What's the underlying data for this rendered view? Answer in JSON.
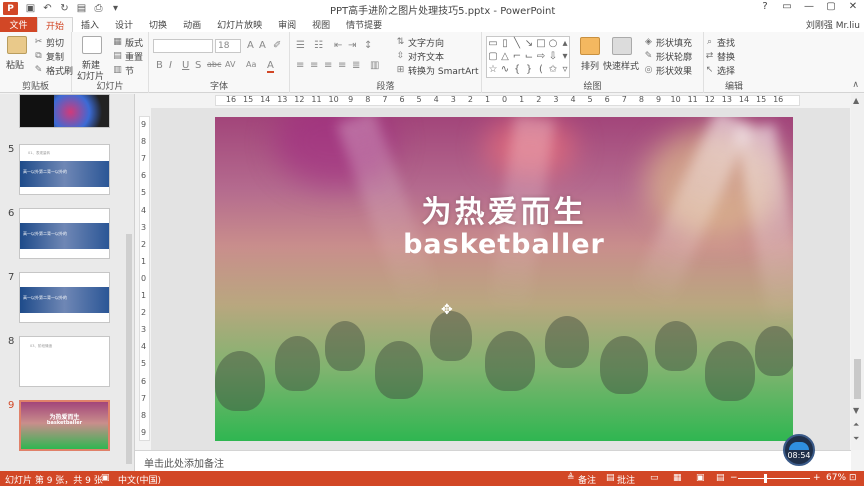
{
  "titlebar": {
    "app_icon": "P",
    "title": "PPT高手进阶之图片处理技巧5.pptx - PowerPoint",
    "qat_icons": [
      "save-icon",
      "undo-icon",
      "redo-icon",
      "start-from-beginning-icon",
      "print-icon",
      "more-icon"
    ],
    "window_buttons": [
      "?",
      "▭",
      "—",
      "▢",
      "✕"
    ]
  },
  "tabs": {
    "file": "文件",
    "items": [
      "开始",
      "插入",
      "设计",
      "切换",
      "动画",
      "幻灯片放映",
      "审阅",
      "视图",
      "情节提要"
    ],
    "active": "开始",
    "user": "刘刚强 Mr.liu"
  },
  "ribbon": {
    "clipboard": {
      "paste": "粘贴",
      "cut": "剪切",
      "copy": "复制",
      "format_painter": "格式刷",
      "label": "剪贴板"
    },
    "slides": {
      "new_slide_1": "新建",
      "new_slide_2": "幻灯片",
      "layout": "版式",
      "reset": "重置",
      "section": "节",
      "label": "幻灯片"
    },
    "font": {
      "size": "18",
      "bold": "B",
      "italic": "I",
      "underline": "U",
      "shadow": "S",
      "strike": "abc",
      "spacing": "AV",
      "case": "Aa",
      "color": "A",
      "label": "字体"
    },
    "paragraph": {
      "text_direction": "文字方向",
      "align_text": "对齐文本",
      "convert_smartart": "转换为 SmartArt",
      "label": "段落"
    },
    "drawing": {
      "arrange": "排列",
      "quick_styles": "快速样式",
      "shape_fill": "形状填充",
      "shape_outline": "形状轮廓",
      "shape_effects": "形状效果",
      "label": "绘图"
    },
    "editing": {
      "find": "查找",
      "replace": "替换",
      "select": "选择",
      "label": "编辑"
    }
  },
  "thumbnails": {
    "items": [
      {
        "num": "",
        "style": "colorful"
      },
      {
        "num": "5",
        "style": "band",
        "small": "01、表现量转",
        "band_text": "高一以外第二背一以外的"
      },
      {
        "num": "6",
        "style": "band",
        "small": "",
        "band_text": "高一以外第二背一以外的"
      },
      {
        "num": "7",
        "style": "band",
        "small": "",
        "band_text": "高一以外第二背一以外的"
      },
      {
        "num": "8",
        "style": "plain",
        "small": "03、阶段情绪"
      },
      {
        "num": "9",
        "style": "active",
        "title": "为热爱而生",
        "sub": "basketballer"
      }
    ]
  },
  "ruler": {
    "h_ticks": [
      "16",
      "15",
      "14",
      "13",
      "12",
      "11",
      "10",
      "9",
      "8",
      "7",
      "6",
      "5",
      "4",
      "3",
      "2",
      "1",
      "0",
      "1",
      "2",
      "3",
      "4",
      "5",
      "6",
      "7",
      "8",
      "9",
      "10",
      "11",
      "12",
      "13",
      "14",
      "15",
      "16"
    ],
    "v_ticks": [
      "9",
      "8",
      "7",
      "6",
      "5",
      "4",
      "3",
      "2",
      "1",
      "0",
      "1",
      "2",
      "3",
      "4",
      "5",
      "6",
      "7",
      "8",
      "9"
    ]
  },
  "slide": {
    "title": "为热爱而生",
    "subtitle": "basketballer"
  },
  "notes": {
    "placeholder": "单击此处添加备注"
  },
  "clock": {
    "time": "08:54"
  },
  "status": {
    "slide_info": "幻灯片 第 9 张，共 9 张",
    "language": "中文(中国)",
    "notes": "备注",
    "comments": "批注",
    "zoom_minus": "−",
    "zoom_plus": "+",
    "zoom": "67%"
  },
  "colors": {
    "accent": "#d24726",
    "ribbon_bg": "#f8f8f8",
    "slide_top": "#a2457a",
    "slide_bottom": "#2fb651"
  }
}
